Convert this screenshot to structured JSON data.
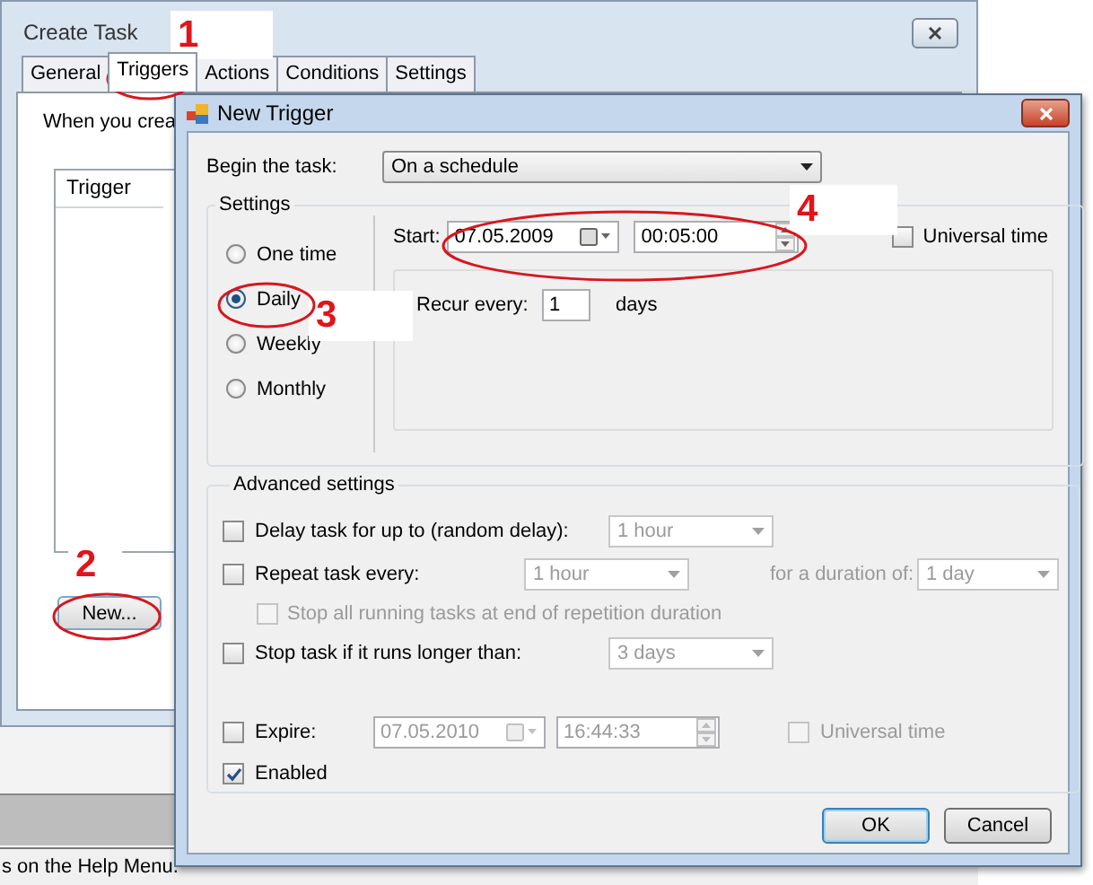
{
  "create_task": {
    "title": "Create Task",
    "tabs": [
      {
        "label": "General",
        "selected": false
      },
      {
        "label": "Triggers",
        "selected": true
      },
      {
        "label": "Actions",
        "selected": false
      },
      {
        "label": "Conditions",
        "selected": false
      },
      {
        "label": "Settings",
        "selected": false
      }
    ],
    "intro": "When you crea",
    "list_header": "Trigger",
    "new_button": "New...",
    "status_text": "s on the Help Menu."
  },
  "new_trigger": {
    "title": "New Trigger",
    "begin_label": "Begin the task:",
    "begin_value": "On a schedule",
    "settings": {
      "title": "Settings",
      "schedules": [
        {
          "label": "One time",
          "selected": false
        },
        {
          "label": "Daily",
          "selected": true
        },
        {
          "label": "Weekly",
          "selected": false
        },
        {
          "label": "Monthly",
          "selected": false
        }
      ],
      "start_label": "Start:",
      "start_date": "07.05.2009",
      "start_time": "00:05:00",
      "universal_time": {
        "label": "Universal time",
        "checked": false
      },
      "recur_label": "Recur every:",
      "recur_value": "1",
      "recur_unit": "days"
    },
    "advanced": {
      "title": "Advanced settings",
      "delay": {
        "label": "Delay task for up to (random delay):",
        "checked": false,
        "value": "1 hour",
        "disabled": true
      },
      "repeat": {
        "label": "Repeat task every:",
        "checked": false,
        "value": "1 hour",
        "disabled": true,
        "duration_label": "for a duration of:",
        "duration_value": "1 day"
      },
      "stop_all": {
        "label": "Stop all running tasks at end of repetition duration",
        "checked": false,
        "disabled": true
      },
      "stop_long": {
        "label": "Stop task if it runs longer than:",
        "checked": false,
        "value": "3 days",
        "disabled": true
      },
      "expire": {
        "label": "Expire:",
        "checked": false,
        "date": "07.05.2010",
        "time": "16:44:33",
        "disabled": true,
        "universal_label": "Universal time",
        "universal_checked": false
      },
      "enabled": {
        "label": "Enabled",
        "checked": true
      }
    },
    "buttons": [
      {
        "label": "OK",
        "default": true
      },
      {
        "label": "Cancel",
        "default": false
      }
    ]
  },
  "annotations": [
    {
      "number": "1"
    },
    {
      "number": "2"
    },
    {
      "number": "3"
    },
    {
      "number": "4"
    }
  ]
}
